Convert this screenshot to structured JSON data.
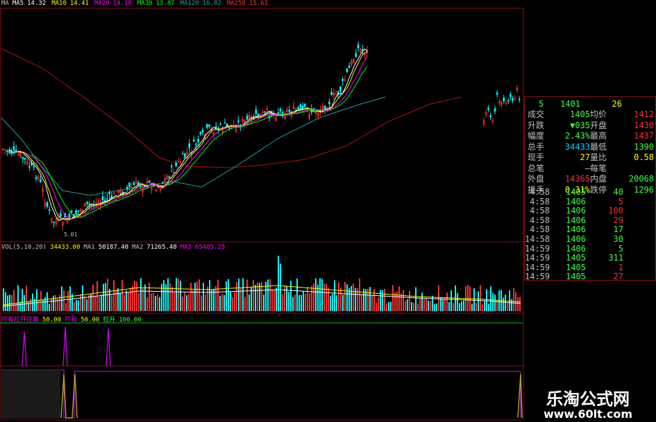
{
  "colors": {
    "up": "#ff3030",
    "down": "#00ffff",
    "ma1": "#ffffff",
    "ma2": "#ffff00",
    "ma3": "#ff00ff",
    "ma4": "#00ff00",
    "ma5": "#1fa0a0",
    "ma6": "#b01010",
    "label": "#c0c0c0",
    "green": "#40ff40",
    "red": "#ff3030",
    "cyan": "#00d8ff",
    "yellow": "#ffff00",
    "magenta": "#e000ff",
    "olive": "#b0a020",
    "border": "#8a1010"
  },
  "main_header": [
    {
      "label": "MA",
      "value": "",
      "color": "#c0c0c0"
    },
    {
      "label": "MA5",
      "value": "14.32",
      "color": "#ffffff"
    },
    {
      "label": "MA10",
      "value": "14.41",
      "color": "#ffff00"
    },
    {
      "label": "MA20",
      "value": "14.18",
      "color": "#ff00ff"
    },
    {
      "label": "MA30",
      "value": "13.87",
      "color": "#00ff00"
    },
    {
      "label": "MA120",
      "value": "16.82",
      "color": "#1fa0a0"
    },
    {
      "label": "MA250",
      "value": "15.61",
      "color": "#ff3030"
    }
  ],
  "low_label": "5.01",
  "vol_header": [
    {
      "text": "VOL(5,10,20)",
      "color": "#c0c0c0"
    },
    {
      "text": "34433.00",
      "color": "#ffff00"
    },
    {
      "text": "MA1",
      "color": "#c0c0c0"
    },
    {
      "text": "50187.40",
      "color": "#ffffff"
    },
    {
      "text": "MA2",
      "color": "#c0c0c0"
    },
    {
      "text": "71265.40",
      "color": "#ffffff"
    },
    {
      "text": "MA3",
      "color": "#ff00ff"
    },
    {
      "text": "65405.25",
      "color": "#ff00ff"
    }
  ],
  "ind_header": [
    {
      "text": "拧有拉升往靠",
      "color": "#ff00ff"
    },
    {
      "text": "50.00",
      "color": "#ffff00"
    },
    {
      "text": "拧有",
      "color": "#ff00ff"
    },
    {
      "text": "50.00",
      "color": "#ffff00"
    },
    {
      "text": "拉升",
      "color": "#40ff40"
    },
    {
      "text": "100.00",
      "color": "#40ff40"
    }
  ],
  "quote_top": {
    "left": "5",
    "mid": "1401",
    "right": "26"
  },
  "quote_rows": [
    {
      "label": "成交",
      "value": "1405",
      "value_color": "#40ff40",
      "label2": "均价",
      "value2": "1412",
      "value2_color": "#ff3030"
    },
    {
      "label": "升跌",
      "value": "▼035",
      "value_color": "#40ff40",
      "label2": "开盘",
      "value2": "1430",
      "value2_color": "#ff3030"
    },
    {
      "label": "幅度",
      "value": "2.43%",
      "value_color": "#40ff40",
      "label2": "最高",
      "value2": "1437",
      "value2_color": "#ff3030"
    },
    {
      "label": "总手",
      "value": "34433",
      "value_color": "#00d8ff",
      "label2": "最低",
      "value2": "1390",
      "value2_color": "#40ff40"
    },
    {
      "label": "现手",
      "value": "27",
      "value_color": "#ffff00",
      "label2": "量比",
      "value2": "0.58",
      "value2_color": "#ffff00"
    },
    {
      "label": "总笔",
      "value": "—",
      "value_color": "#c0c0c0",
      "label2": "每笔",
      "value2": "",
      "value2_color": "#c0c0c0"
    },
    {
      "label": "外盘",
      "value": "14365",
      "value_color": "#ff3030",
      "label2": "内盘",
      "value2": "20068",
      "value2_color": "#40ff40"
    },
    {
      "label": "换手",
      "value": "0.31%",
      "value_color": "#ffff00",
      "label2": "跌停",
      "value2": "1296",
      "value2_color": "#40ff40"
    }
  ],
  "ticks": [
    {
      "time": "4:58",
      "price": "1405",
      "vol": "40",
      "vol_color": "#40ff40"
    },
    {
      "time": "4:58",
      "price": "1406",
      "vol": "5",
      "vol_color": "#ff3030"
    },
    {
      "time": "4:58",
      "price": "1406",
      "vol": "100",
      "vol_color": "#ff3030"
    },
    {
      "time": "4:58",
      "price": "1406",
      "vol": "29",
      "vol_color": "#ff3030"
    },
    {
      "time": "4:58",
      "price": "1406",
      "vol": "17",
      "vol_color": "#40ff40"
    },
    {
      "time": "14:58",
      "price": "1406",
      "vol": "30",
      "vol_color": "#40ff40"
    },
    {
      "time": "14:59",
      "price": "1406",
      "vol": "5",
      "vol_color": "#40ff40"
    },
    {
      "time": "14:59",
      "price": "1405",
      "vol": "311",
      "vol_color": "#40ff40"
    },
    {
      "time": "14:59",
      "price": "1405",
      "vol": "1",
      "vol_color": "#ff3030"
    },
    {
      "time": "14:59",
      "price": "1405",
      "vol": "27",
      "vol_color": "#ff3030"
    }
  ],
  "watermark": {
    "title": "乐淘公式网",
    "url": "www.60lt.com"
  }
}
